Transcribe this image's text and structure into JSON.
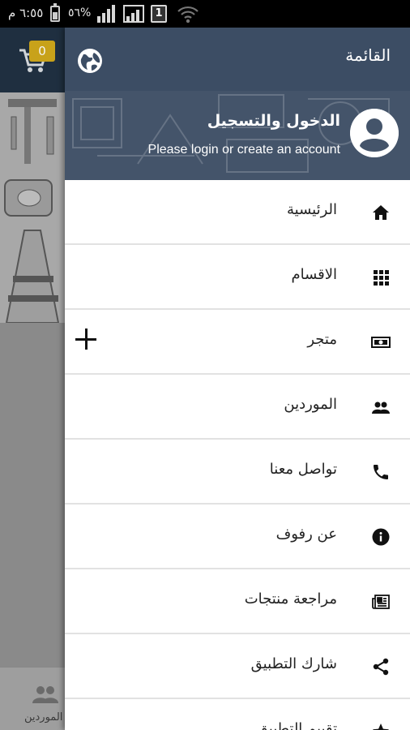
{
  "status_bar": {
    "time": "٦:٥٥ م",
    "battery_percent": "٥٦%",
    "sim_slot": "1"
  },
  "background_app": {
    "cart_count": "0",
    "bottom_nav_label": "الموردين"
  },
  "drawer": {
    "title": "القائمة",
    "login_title": "الدخول والتسجيل",
    "login_subtitle": "Please login or create an account",
    "menu": [
      {
        "label": "الرئيسية",
        "icon": "home-icon"
      },
      {
        "label": "الاقسام",
        "icon": "grid-icon"
      },
      {
        "label": "متجر",
        "icon": "money-icon",
        "expandable": true
      },
      {
        "label": "الموردين",
        "icon": "people-icon"
      },
      {
        "label": "تواصل معنا",
        "icon": "phone-icon"
      },
      {
        "label": "عن رفوف",
        "icon": "info-icon"
      },
      {
        "label": "مراجعة منتجات",
        "icon": "newspaper-icon"
      },
      {
        "label": "شارك التطبيق",
        "icon": "share-icon"
      },
      {
        "label": "تقييم التطبيق",
        "icon": "star-icon"
      }
    ]
  },
  "colors": {
    "header_bar": "#3c4d64",
    "header_user_area": "#44546a",
    "badge": "#c8a21a",
    "divider": "#e2e2e2"
  }
}
